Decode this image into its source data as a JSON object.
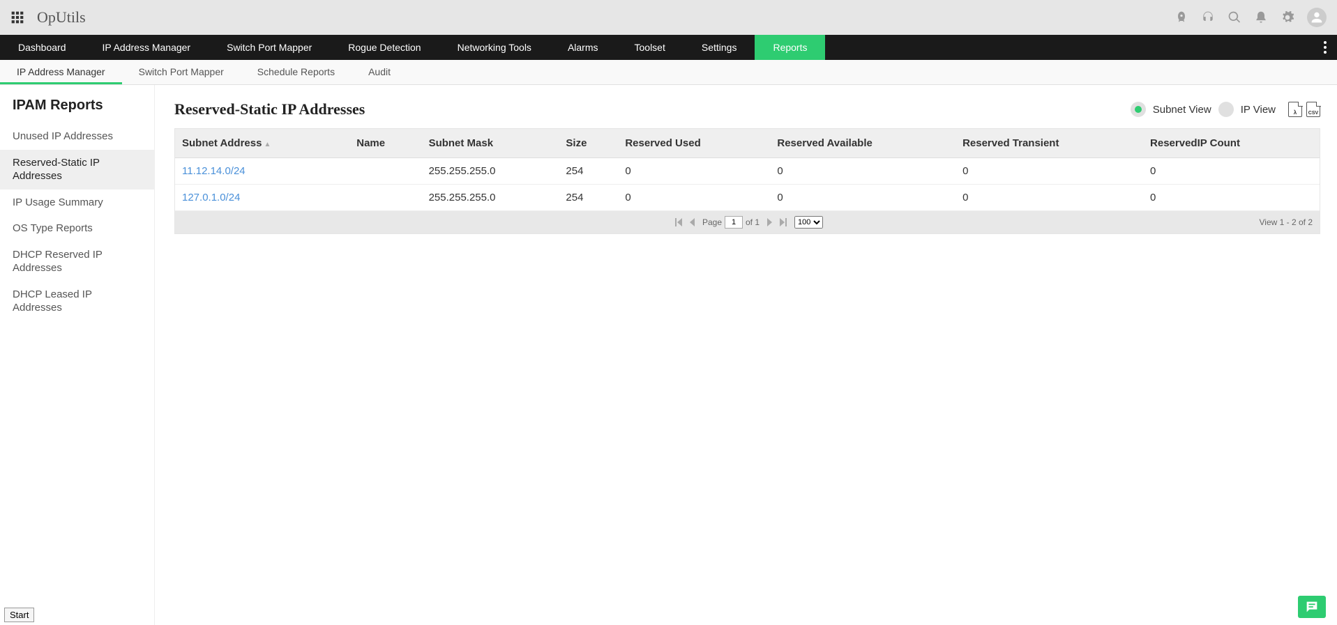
{
  "app": {
    "title": "OpUtils"
  },
  "main_nav": {
    "items": [
      "Dashboard",
      "IP Address Manager",
      "Switch Port Mapper",
      "Rogue Detection",
      "Networking Tools",
      "Alarms",
      "Toolset",
      "Settings",
      "Reports"
    ],
    "active": "Reports"
  },
  "sub_nav": {
    "items": [
      "IP Address Manager",
      "Switch Port Mapper",
      "Schedule Reports",
      "Audit"
    ],
    "active": "IP Address Manager"
  },
  "sidebar": {
    "title": "IPAM Reports",
    "items": [
      "Unused IP Addresses",
      "Reserved-Static IP Addresses",
      "IP Usage Summary",
      "OS Type Reports",
      "DHCP Reserved IP Addresses",
      "DHCP Leased IP Addresses"
    ],
    "active": "Reserved-Static IP Addresses"
  },
  "page": {
    "title": "Reserved-Static IP Addresses",
    "view_toggle": {
      "subnet": "Subnet View",
      "ip": "IP View",
      "selected": "subnet"
    },
    "export": {
      "pdf": "PDF",
      "csv": "CSV"
    }
  },
  "table": {
    "columns": [
      "Subnet Address",
      "Name",
      "Subnet Mask",
      "Size",
      "Reserved Used",
      "Reserved Available",
      "Reserved Transient",
      "ReservedIP Count"
    ],
    "rows": [
      {
        "subnet": "11.12.14.0/24",
        "name": "",
        "mask": "255.255.255.0",
        "size": "254",
        "used": "0",
        "avail": "0",
        "trans": "0",
        "count": "0"
      },
      {
        "subnet": "127.0.1.0/24",
        "name": "",
        "mask": "255.255.255.0",
        "size": "254",
        "used": "0",
        "avail": "0",
        "trans": "0",
        "count": "0"
      }
    ]
  },
  "pager": {
    "page_label": "Page",
    "current": "1",
    "of_label": "of 1",
    "page_size": "100",
    "view_info": "View 1 - 2 of 2"
  },
  "footer": {
    "start": "Start"
  }
}
